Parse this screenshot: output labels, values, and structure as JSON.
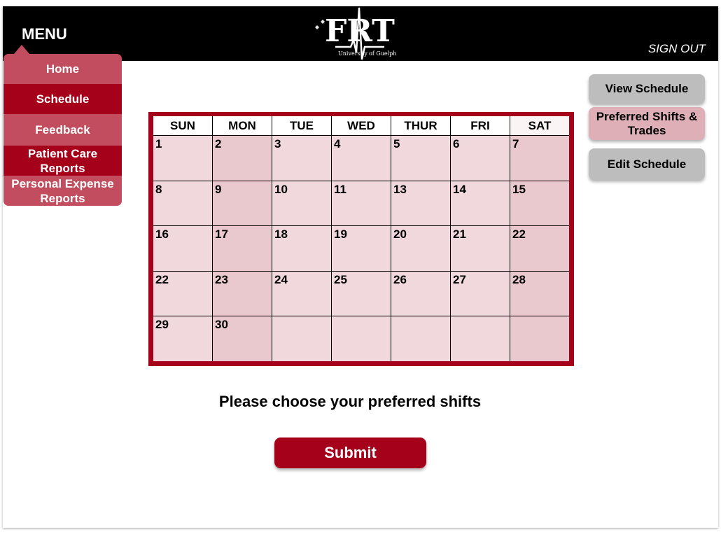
{
  "header": {
    "menu_label": "MENU",
    "logo_text": "FRT",
    "logo_sub_left": "University",
    "logo_sub_right": "of Guelph",
    "sign_out": "SIGN OUT"
  },
  "menu": {
    "items": [
      {
        "label": "Home"
      },
      {
        "label": "Schedule"
      },
      {
        "label": "Feedback"
      },
      {
        "label": "Patient Care Reports"
      },
      {
        "label": "Personal Expense Reports"
      }
    ]
  },
  "calendar": {
    "days": [
      "SUN",
      "MON",
      "TUE",
      "WED",
      "THUR",
      "FRI",
      "SAT"
    ],
    "weeks": [
      [
        "1",
        "2",
        "3",
        "4",
        "5",
        "6",
        "7"
      ],
      [
        "8",
        "9",
        "10",
        "11",
        "13",
        "14",
        "15"
      ],
      [
        "16",
        "17",
        "18",
        "19",
        "20",
        "21",
        "22"
      ],
      [
        "22",
        "23",
        "24",
        "25",
        "26",
        "27",
        "28"
      ],
      [
        "29",
        "30",
        "",
        "",
        "",
        "",
        ""
      ]
    ]
  },
  "main": {
    "prompt": "Please choose your preferred shifts",
    "submit_label": "Submit"
  },
  "side_buttons": {
    "view_schedule": "View Schedule",
    "preferred_shifts": "Preferred Shifts & Trades",
    "edit_schedule": "Edit Schedule"
  },
  "colors": {
    "brand_red": "#a5011a",
    "menu_light": "#c24d5e",
    "calendar_cell": "#f0d8dc",
    "active_side_button": "#deafb7"
  }
}
